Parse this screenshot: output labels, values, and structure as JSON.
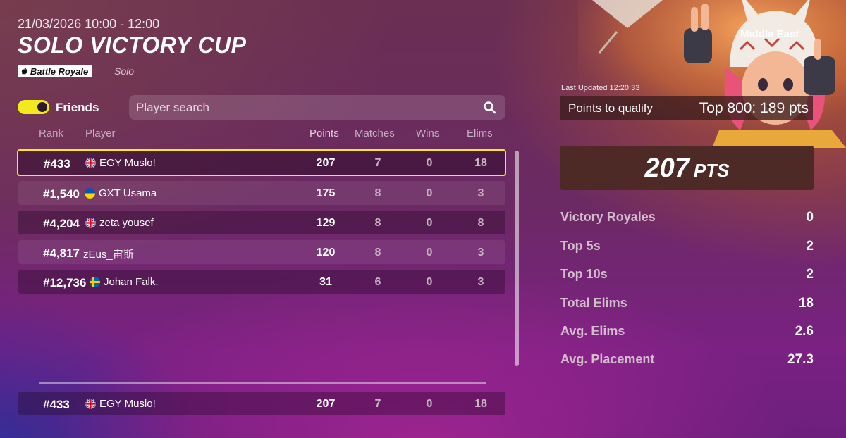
{
  "header": {
    "date_time": "21/03/2026 10:00 - 12:00",
    "title": "SOLO VICTORY CUP",
    "mode_badge": "Battle Royale",
    "mode_type": "Solo"
  },
  "filters": {
    "friends_label": "Friends",
    "friends_on": true,
    "search_placeholder": "Player search"
  },
  "columns": {
    "rank": "Rank",
    "player": "Player",
    "points": "Points",
    "matches": "Matches",
    "wins": "Wins",
    "elims": "Elims"
  },
  "leaderboard": [
    {
      "rank": "#433",
      "flag": "uk",
      "player": "EGY Muslo!",
      "points": "207",
      "matches": "7",
      "wins": "0",
      "elims": "18"
    },
    {
      "rank": "#1,540",
      "flag": "ukraine",
      "player": "GXT Usama",
      "points": "175",
      "matches": "8",
      "wins": "0",
      "elims": "3"
    },
    {
      "rank": "#4,204",
      "flag": "uk",
      "player": "zeta yousef",
      "points": "129",
      "matches": "8",
      "wins": "0",
      "elims": "8"
    },
    {
      "rank": "#4,817",
      "flag": "",
      "player": "zEus_宙斯",
      "points": "120",
      "matches": "8",
      "wins": "0",
      "elims": "3"
    },
    {
      "rank": "#12,736",
      "flag": "sweden",
      "player": "Johan Falk.",
      "points": "31",
      "matches": "6",
      "wins": "0",
      "elims": "3"
    }
  ],
  "my_row": {
    "rank": "#433",
    "flag": "uk",
    "player": "EGY Muslo!",
    "points": "207",
    "matches": "7",
    "wins": "0",
    "elims": "18"
  },
  "summary": {
    "region": "Middle East",
    "last_updated": "Last Updated 12:20:33",
    "qualify_label": "Points to qualify",
    "qualify_value": "Top 800: 189 pts",
    "points": "207",
    "points_unit": "PTS",
    "stats": [
      {
        "label": "Victory Royales",
        "value": "0"
      },
      {
        "label": "Top 5s",
        "value": "2"
      },
      {
        "label": "Top 10s",
        "value": "2"
      },
      {
        "label": "Total Elims",
        "value": "18"
      },
      {
        "label": "Avg. Elims",
        "value": "2.6"
      },
      {
        "label": "Avg. Placement",
        "value": "27.3"
      }
    ]
  },
  "icons": {
    "search": "search-icon",
    "crown": "crown-icon",
    "flag_uk": "uk-flag-icon",
    "flag_ukraine": "ukraine-flag-icon",
    "flag_sweden": "sweden-flag-icon"
  },
  "colors": {
    "accent": "#f2ea1e",
    "panel": "#4e2a27"
  }
}
